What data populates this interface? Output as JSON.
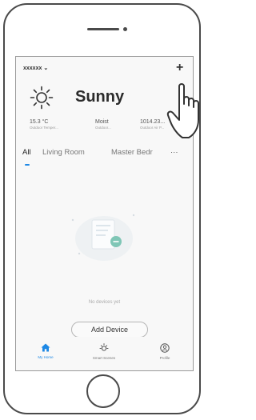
{
  "header": {
    "home_name": "xxxxxx",
    "add_label": "+"
  },
  "weather": {
    "condition": "Sunny",
    "icon": "sun-icon",
    "stats": [
      {
        "value": "15.3 °C",
        "label": "Outdoor Temper..."
      },
      {
        "value": "Moist",
        "label": "Outdoor..."
      },
      {
        "value": "1014.23...",
        "label": "Outdoor Air P..."
      }
    ]
  },
  "tabs": [
    "All",
    "Living Room",
    "Master Bedr",
    "···"
  ],
  "empty_state": {
    "message": "No devices yet",
    "button_label": "Add Device"
  },
  "nav": [
    {
      "label": "My Home",
      "icon": "home-icon",
      "active": true
    },
    {
      "label": "Smart Scenes",
      "icon": "scene-icon",
      "active": false
    },
    {
      "label": "Profile",
      "icon": "profile-icon",
      "active": false
    }
  ],
  "colors": {
    "accent": "#1e88e5",
    "device_outline": "#4a4a4a"
  }
}
